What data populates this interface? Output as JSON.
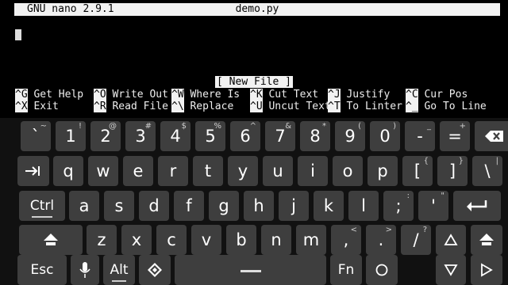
{
  "terminal": {
    "app_label": "GNU nano 2.9.1",
    "filename": "demo.py",
    "status": "[ New File ]",
    "shortcuts_row1": [
      {
        "key": "^G",
        "label": "Get Help"
      },
      {
        "key": "^O",
        "label": "Write Out"
      },
      {
        "key": "^W",
        "label": "Where Is"
      },
      {
        "key": "^K",
        "label": "Cut Text"
      },
      {
        "key": "^J",
        "label": "Justify"
      },
      {
        "key": "^C",
        "label": "Cur Pos"
      }
    ],
    "shortcuts_row2": [
      {
        "key": "^X",
        "label": "Exit"
      },
      {
        "key": "^R",
        "label": "Read File"
      },
      {
        "key": "^\\",
        "label": "Replace"
      },
      {
        "key": "^U",
        "label": "Uncut Text"
      },
      {
        "key": "^T",
        "label": "To Linter"
      },
      {
        "key": "^_",
        "label": "Go To Line"
      }
    ]
  },
  "keyboard": {
    "row1": [
      {
        "label": "`",
        "sec": "~"
      },
      {
        "label": "1",
        "sec": "!"
      },
      {
        "label": "2",
        "sec": "@"
      },
      {
        "label": "3",
        "sec": "#"
      },
      {
        "label": "4",
        "sec": "$"
      },
      {
        "label": "5",
        "sec": "%"
      },
      {
        "label": "6",
        "sec": "^"
      },
      {
        "label": "7",
        "sec": "&"
      },
      {
        "label": "8",
        "sec": "*"
      },
      {
        "label": "9",
        "sec": "("
      },
      {
        "label": "0",
        "sec": ")"
      },
      {
        "label": "-",
        "sec": "_"
      },
      {
        "label": "=",
        "sec": "+"
      }
    ],
    "row2": [
      {
        "label": "q"
      },
      {
        "label": "w"
      },
      {
        "label": "e"
      },
      {
        "label": "r"
      },
      {
        "label": "t"
      },
      {
        "label": "y"
      },
      {
        "label": "u"
      },
      {
        "label": "i"
      },
      {
        "label": "o"
      },
      {
        "label": "p"
      },
      {
        "label": "[",
        "sec": "{"
      },
      {
        "label": "]",
        "sec": "}"
      },
      {
        "label": "\\",
        "sec": "|"
      }
    ],
    "row3_ctrl": "Ctrl",
    "row3": [
      {
        "label": "a"
      },
      {
        "label": "s"
      },
      {
        "label": "d"
      },
      {
        "label": "f"
      },
      {
        "label": "g"
      },
      {
        "label": "h"
      },
      {
        "label": "j"
      },
      {
        "label": "k"
      },
      {
        "label": "l"
      },
      {
        "label": ";",
        "sec": ":"
      },
      {
        "label": "'",
        "sec": "\""
      }
    ],
    "row4": [
      {
        "label": "z"
      },
      {
        "label": "x"
      },
      {
        "label": "c"
      },
      {
        "label": "v"
      },
      {
        "label": "b"
      },
      {
        "label": "n"
      },
      {
        "label": "m"
      },
      {
        "label": ",",
        "sec": "<"
      },
      {
        "label": ".",
        "sec": ">"
      },
      {
        "label": "/",
        "sec": "?"
      }
    ],
    "row5_esc": "Esc",
    "row5_alt": "Alt",
    "row5_fn": "Fn",
    "icons": {
      "backspace": "backspace-icon",
      "tab": "tab-icon",
      "enter": "enter-icon",
      "shift": "shift-icon",
      "mic": "microphone-icon",
      "settings": "diamond-icon",
      "space": "space-icon",
      "circle": "home-circle-icon",
      "up": "arrow-up-icon",
      "down": "arrow-down-icon",
      "right": "arrow-right-icon"
    }
  }
}
